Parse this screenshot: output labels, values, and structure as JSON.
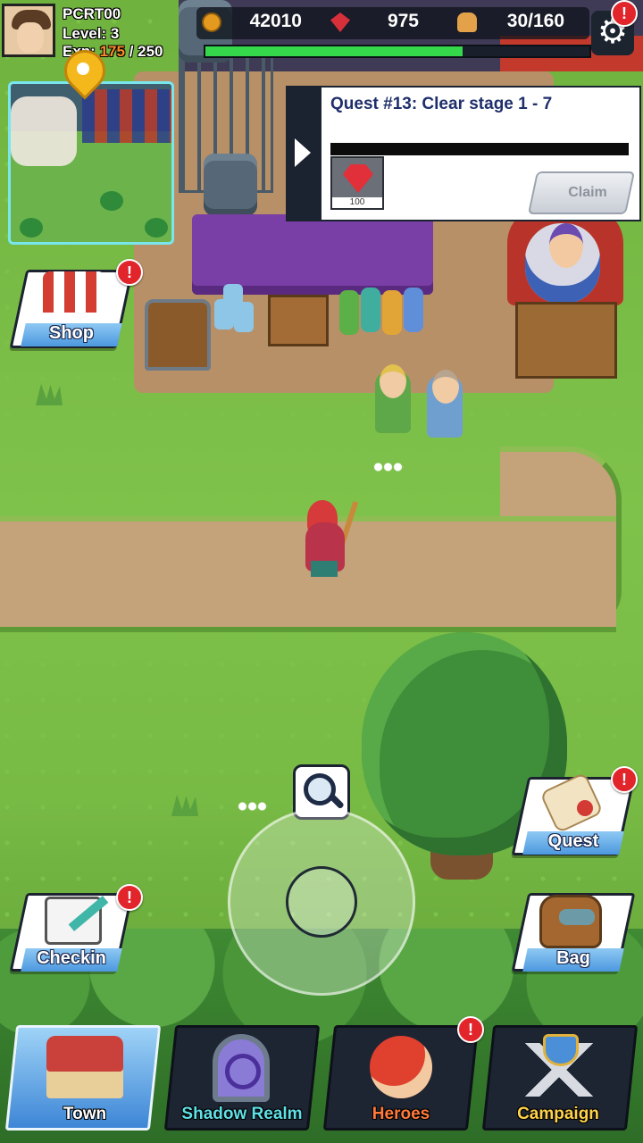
{
  "player": {
    "name": "PCRT00",
    "level_text": "Level: 3",
    "exp_label": "Exp:",
    "exp_current": "175",
    "exp_max": "/ 250",
    "hp_fraction": 0.67
  },
  "resources": {
    "gold": "42010",
    "gems": "975",
    "stamina": "30/160",
    "gold_icon": "coin-icon",
    "gem_icon": "gem-icon",
    "stamina_icon": "bread-icon"
  },
  "alerts": {
    "mark": "!"
  },
  "quest_panel": {
    "title": "Quest #13: Clear stage 1 - 7",
    "progress": 0,
    "reward_quantity": "100",
    "reward_icon": "ruby-gem-icon",
    "claim_label": "Claim"
  },
  "side_buttons": {
    "shop": "Shop",
    "quest": "Quest",
    "checkin": "Checkin",
    "bag": "Bag"
  },
  "nav": {
    "tabs": [
      {
        "label": "Town",
        "color": "#ffffff",
        "icon": "town-castle-icon"
      },
      {
        "label": "Shadow Realm",
        "color": "#5fe0e6",
        "icon": "portal-icon"
      },
      {
        "label": "Heroes",
        "color": "#ff7a3a",
        "icon": "hero-head-icon"
      },
      {
        "label": "Campaign",
        "color": "#ffd24a",
        "icon": "crossed-swords-icon"
      }
    ],
    "active": "Town"
  },
  "colors": {
    "hp_bar": "#34d84a",
    "alert_red": "#e2242b",
    "quest_title": "#1f2f6b",
    "exp_highlight": "#ff8a2a"
  }
}
